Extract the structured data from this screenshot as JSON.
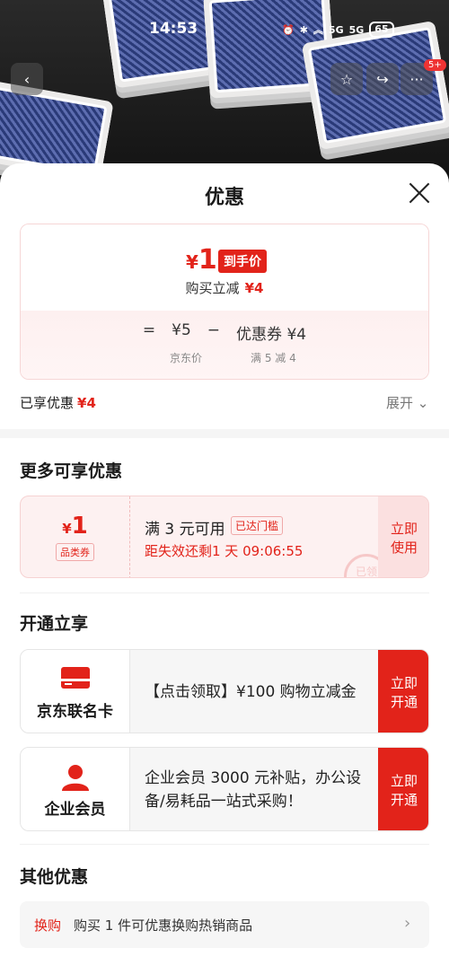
{
  "status_bar": {
    "time": "14:53",
    "net1": "5G",
    "net2": "5G",
    "battery": "65"
  },
  "hero": {
    "badge": "5+"
  },
  "sheet": {
    "title": "优惠"
  },
  "price": {
    "final_currency": "¥",
    "final_value": "1",
    "final_tag": "到手价",
    "reduce_label": "购买立减",
    "reduce_value": "¥4",
    "eq": "=",
    "base_price": "¥5",
    "minus": "−",
    "coupon_label": "优惠券 ¥4",
    "base_caption": "京东价",
    "coupon_caption": "满 5 减 4"
  },
  "enjoyed": {
    "label": "已享优惠",
    "value": "¥4",
    "expand": "展开"
  },
  "more": {
    "title": "更多可享优惠",
    "coupon": {
      "currency": "¥",
      "amount": "1",
      "type": "品类券",
      "condition": "满 3 元可用",
      "reached": "已达门槛",
      "expire": "距失效还剩1 天 09:06:55",
      "button_l1": "立即",
      "button_l2": "使用",
      "stamp": "已领"
    }
  },
  "open": {
    "title": "开通立享",
    "items": [
      {
        "name": "京东联名卡",
        "desc": "【点击领取】¥100 购物立减金",
        "btn_l1": "立即",
        "btn_l2": "开通"
      },
      {
        "name": "企业会员",
        "desc": "企业会员 3000 元补贴，办公设备/易耗品一站式采购！",
        "btn_l1": "立即",
        "btn_l2": "开通"
      }
    ]
  },
  "other": {
    "title": "其他优惠",
    "swap_tag": "换购",
    "swap_text": "购买 1 件可优惠换购热销商品"
  },
  "colors": {
    "accent": "#e2231a"
  }
}
